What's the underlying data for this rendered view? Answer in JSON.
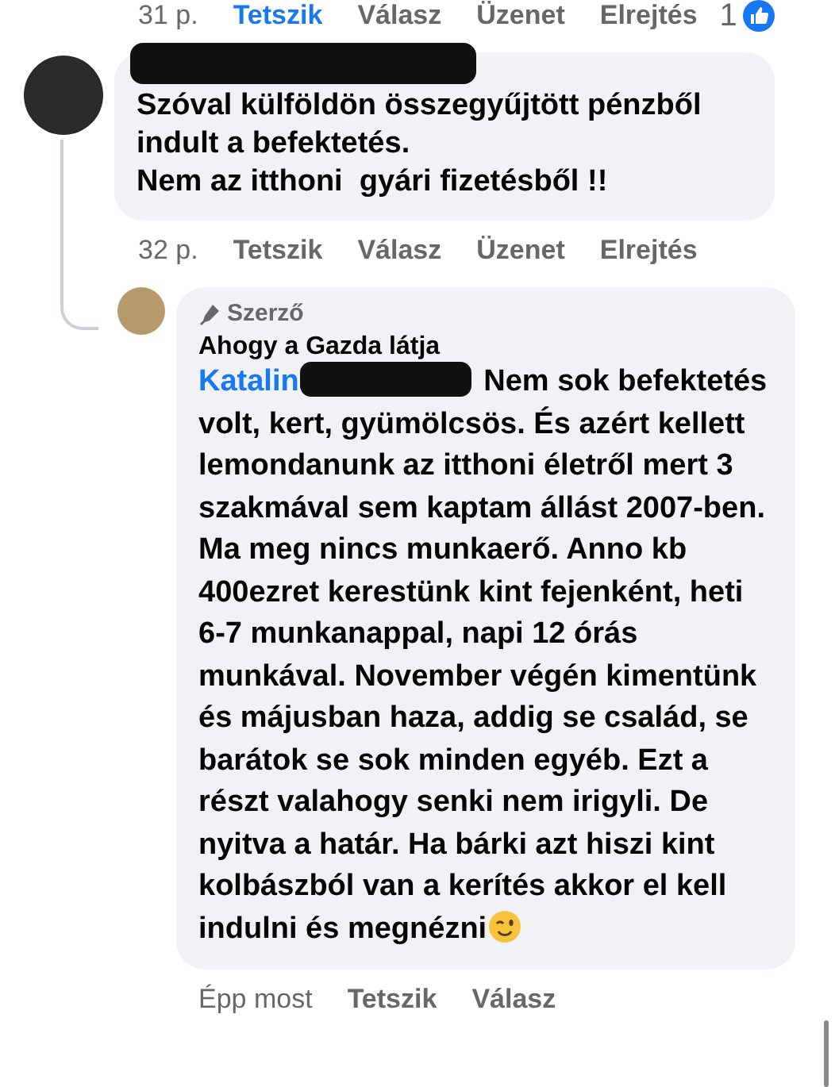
{
  "previous_comment_footer": {
    "time": "31 p.",
    "actions": [
      {
        "label": "Tetszik",
        "selected": true
      },
      {
        "label": "Válasz",
        "selected": false
      },
      {
        "label": "Üzenet",
        "selected": false
      },
      {
        "label": "Elrejtés",
        "selected": false
      }
    ],
    "reaction_count": "1"
  },
  "comment": {
    "text": "Szóval külföldön összegyűjtött pénzből\nindult a befektetés.\nNem az itthoni  gyári fizetésből !!",
    "time": "32 p.",
    "actions": [
      {
        "label": "Tetszik",
        "selected": false
      },
      {
        "label": "Válasz",
        "selected": false
      },
      {
        "label": "Üzenet",
        "selected": false
      },
      {
        "label": "Elrejtés",
        "selected": false
      }
    ]
  },
  "reply": {
    "badge": "Szerző",
    "author": "Ahogy a Gazda látja",
    "mention": "Katalin",
    "text": "Nem sok befektetés volt, kert, gyümölcsös. És azért kellett lemondanunk az itthoni életről mert 3 szakmával sem kaptam állást 2007-ben. Ma meg nincs munkaerő. Anno kb 400ezret kerestünk kint fejenként, heti 6-7 munkanappal, napi 12 órás munkával. November végén kimentünk és májusban haza, addig se család, se barátok se sok minden egyéb. Ezt a részt valahogy senki nem irigyli. De nyitva a határ. Ha bárki azt hiszi kint kolbászból van a kerítés akkor el kell indulni és megnézni",
    "time": "Épp most",
    "actions": [
      {
        "label": "Tetszik",
        "selected": false
      },
      {
        "label": "Válasz",
        "selected": false
      }
    ]
  }
}
